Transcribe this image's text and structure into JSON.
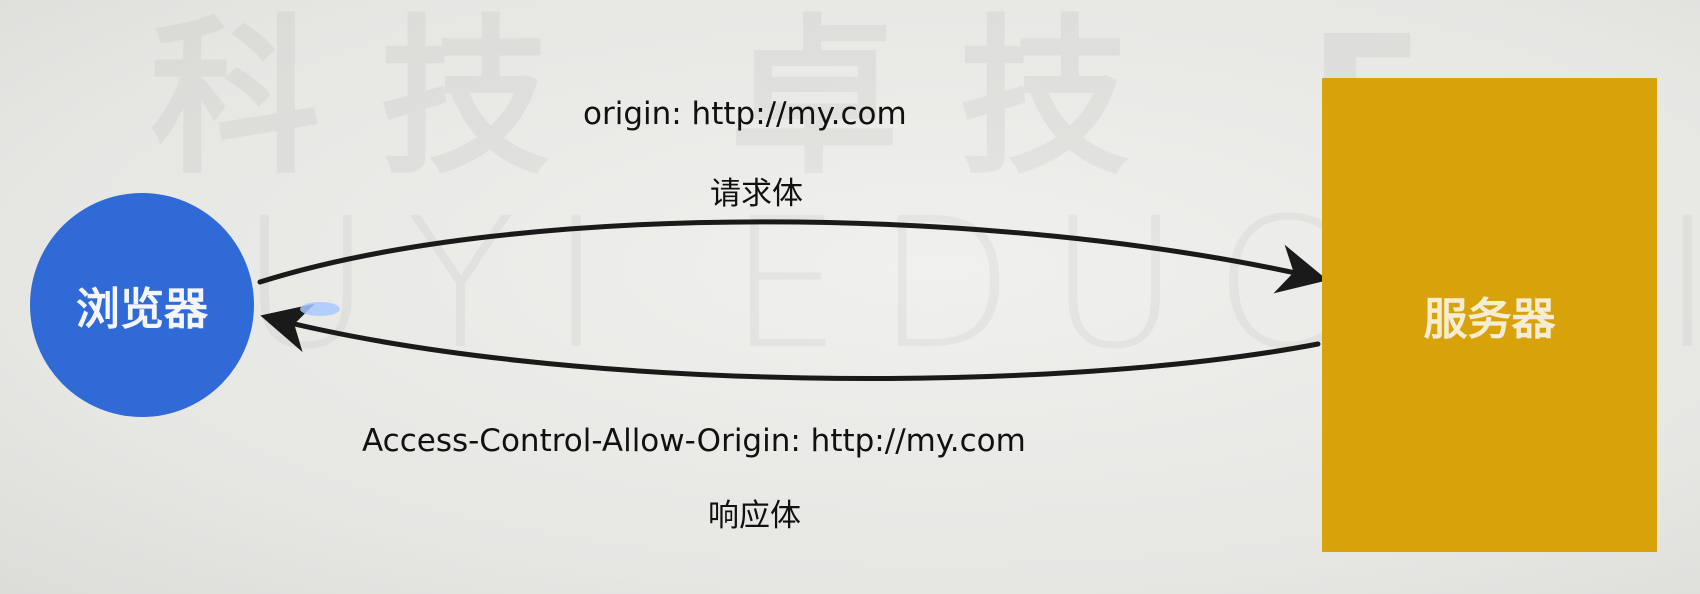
{
  "diagram": {
    "watermark_top": "科技 卓技 E",
    "watermark_mid": "UYI EDUCATION",
    "nodes": {
      "browser": {
        "label": "浏览器",
        "color": "#2f6ad7"
      },
      "server": {
        "label": "服务器",
        "color": "#d8a30a"
      }
    },
    "request": {
      "header": "origin: http://my.com",
      "body": "请求体",
      "direction": "browser-to-server"
    },
    "response": {
      "header": "Access-Control-Allow-Origin: http://my.com",
      "body": "响应体",
      "direction": "server-to-browser"
    }
  }
}
